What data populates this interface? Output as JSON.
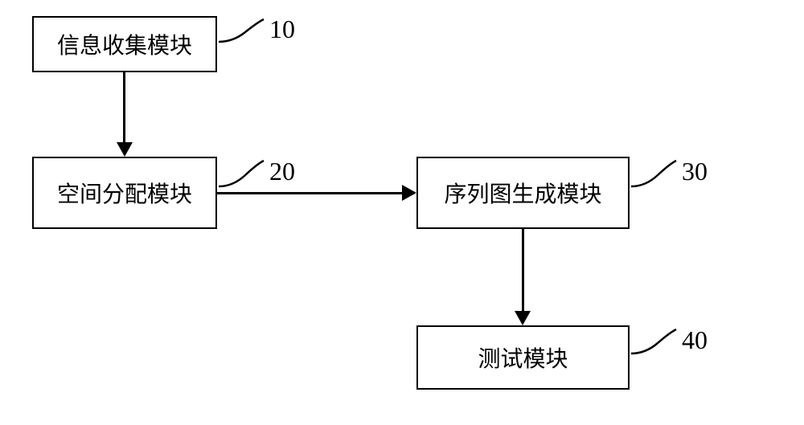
{
  "boxes": {
    "b10": {
      "label": "信息收集模块",
      "num": "10"
    },
    "b20": {
      "label": "空间分配模块",
      "num": "20"
    },
    "b30": {
      "label": "序列图生成模块",
      "num": "30"
    },
    "b40": {
      "label": "测试模块",
      "num": "40"
    }
  }
}
